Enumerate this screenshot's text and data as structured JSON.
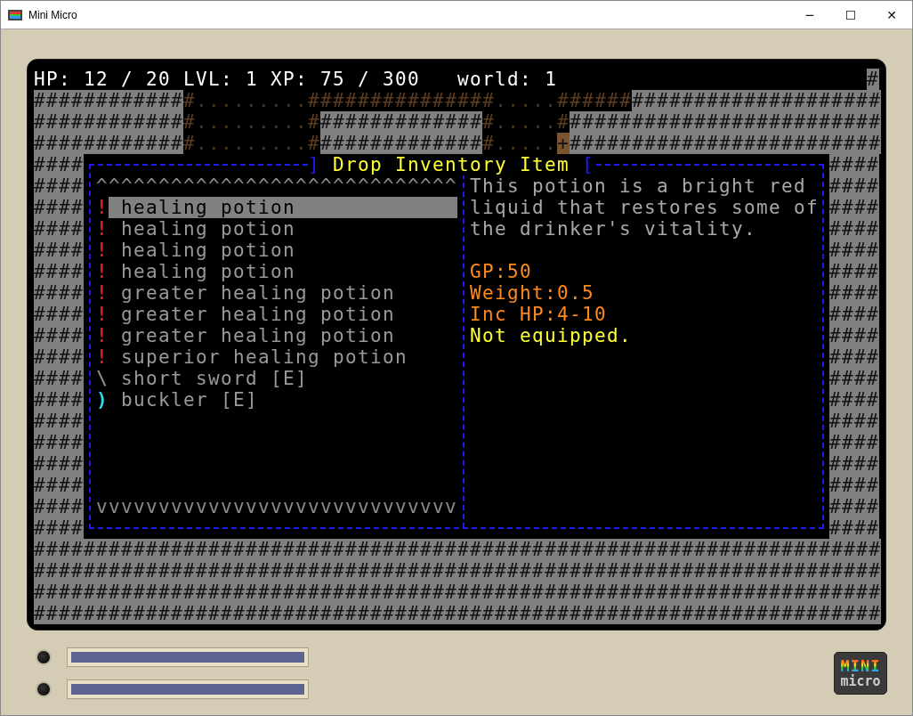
{
  "window": {
    "title": "Mini Micro",
    "controls": [
      "─",
      "☐",
      "✕"
    ]
  },
  "status_bar": {
    "text": "HP: 12 / 20 LVL: 1 XP: 75 / 300   world: 1",
    "wall": "#"
  },
  "map_top": [
    [
      {
        "kind": "wall",
        "text": "############"
      },
      {
        "kind": "dark_wall",
        "text": "#"
      },
      {
        "kind": "floor",
        "text": "........."
      },
      {
        "kind": "dark_wall",
        "text": "###############"
      },
      {
        "kind": "floor",
        "text": "....."
      },
      {
        "kind": "dark_wall",
        "text": "######"
      },
      {
        "kind": "wall",
        "text": "####################"
      }
    ],
    [
      {
        "kind": "wall",
        "text": "############"
      },
      {
        "kind": "dark_wall",
        "text": "#"
      },
      {
        "kind": "floor",
        "text": "........."
      },
      {
        "kind": "dark_wall",
        "text": "#"
      },
      {
        "kind": "wall",
        "text": "#############"
      },
      {
        "kind": "dark_wall",
        "text": "#"
      },
      {
        "kind": "floor",
        "text": "....."
      },
      {
        "kind": "dark_wall",
        "text": "#"
      },
      {
        "kind": "wall",
        "text": "#########################"
      }
    ],
    [
      {
        "kind": "wall",
        "text": "############"
      },
      {
        "kind": "dark_wall",
        "text": "#"
      },
      {
        "kind": "floor",
        "text": "........."
      },
      {
        "kind": "dark_wall",
        "text": "#"
      },
      {
        "kind": "wall",
        "text": "#############"
      },
      {
        "kind": "dark_wall",
        "text": "#"
      },
      {
        "kind": "floor",
        "text": "....."
      },
      {
        "kind": "door",
        "text": "+"
      },
      {
        "kind": "wall",
        "text": "#########################"
      }
    ]
  ],
  "left_wall": [
    "####",
    "####",
    "####",
    "####",
    "####",
    "####",
    "####",
    "####",
    "####",
    "####",
    "####",
    "####",
    "####",
    "####",
    "####",
    "####",
    "####",
    "####"
  ],
  "right_wall": [
    "####",
    "####",
    "####",
    "####",
    "####",
    "####",
    "####",
    "####",
    "####",
    "####",
    "####",
    "####",
    "####",
    "####",
    "####",
    "####",
    "####",
    "####"
  ],
  "dialog": {
    "left_bracket": "]",
    "title": "Drop Inventory Item",
    "right_bracket": "[",
    "scroll_up": "^^^^^^^^^^^^^^^^^^^^^^^^^^^^^",
    "scroll_down": "vvvvvvvvvvvvvvvvvvvvvvvvvvvvv",
    "items": [
      {
        "symbol": "!",
        "color": "#e01818",
        "name": "healing potion",
        "selected": true
      },
      {
        "symbol": "!",
        "color": "#e01818",
        "name": "healing potion",
        "selected": false
      },
      {
        "symbol": "!",
        "color": "#e01818",
        "name": "healing potion",
        "selected": false
      },
      {
        "symbol": "!",
        "color": "#e01818",
        "name": "healing potion",
        "selected": false
      },
      {
        "symbol": "!",
        "color": "#e01818",
        "name": "greater healing potion",
        "selected": false
      },
      {
        "symbol": "!",
        "color": "#e01818",
        "name": "greater healing potion",
        "selected": false
      },
      {
        "symbol": "!",
        "color": "#e01818",
        "name": "greater healing potion",
        "selected": false
      },
      {
        "symbol": "!",
        "color": "#e01818",
        "name": "superior healing potion",
        "selected": false
      },
      {
        "symbol": "\\",
        "color": "#8a8a8a",
        "name": "short sword [E]",
        "selected": false
      },
      {
        "symbol": ")",
        "color": "#30d8e8",
        "name": "buckler [E]",
        "selected": false
      }
    ],
    "description": "This potion is a bright red liquid that restores some of the drinker's vitality.",
    "stats": [
      {
        "kind": "stat",
        "text": "GP:50"
      },
      {
        "kind": "stat",
        "text": "Weight:0.5"
      },
      {
        "kind": "stat",
        "text": "Inc HP:4-10"
      },
      {
        "kind": "status",
        "text": "Not equipped."
      }
    ]
  },
  "map_bottom": [
    "####################################################################",
    "####################################################################",
    "####################################################################",
    "####################################################################"
  ],
  "logo": {
    "top": "MINI",
    "bottom": "micro"
  }
}
